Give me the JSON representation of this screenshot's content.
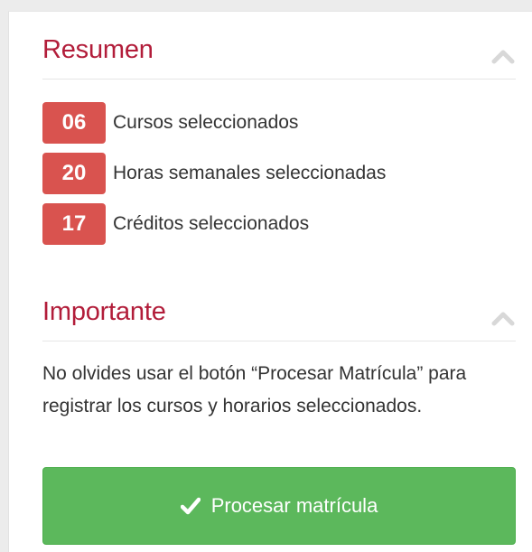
{
  "resumen": {
    "title": "Resumen",
    "collapse_icon": "chevron-up-icon",
    "items": [
      {
        "count": "06",
        "label": "Cursos seleccionados"
      },
      {
        "count": "20",
        "label": "Horas semanales seleccionadas"
      },
      {
        "count": "17",
        "label": "Créditos seleccionados"
      }
    ]
  },
  "importante": {
    "title": "Importante",
    "collapse_icon": "chevron-up-icon",
    "message": "No olvides usar el botón “Procesar Matrícula” para registrar los cursos y horarios seleccionados."
  },
  "submit_button": {
    "label": "Procesar matrícula",
    "icon": "check-icon"
  },
  "colors": {
    "title": "#b21d3a",
    "badge": "#d9534f",
    "button": "#5cb85c",
    "chevron": "#d8d8d8"
  }
}
